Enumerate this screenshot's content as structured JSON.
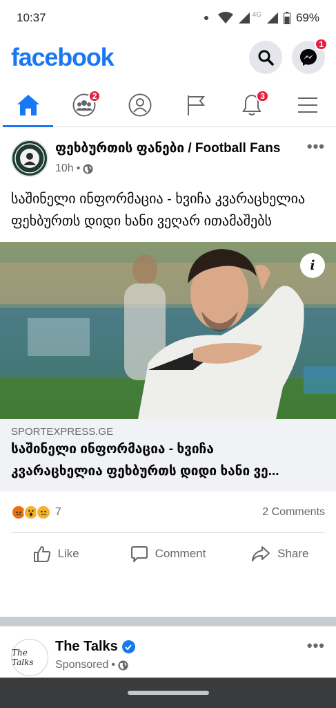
{
  "status_bar": {
    "time": "10:37",
    "network": "4G",
    "battery": "69%"
  },
  "header": {
    "logo": "facebook",
    "messenger_badge": "1"
  },
  "nav": {
    "groups_badge": "2",
    "notifications_badge": "3"
  },
  "post": {
    "page_name": "ფეხბურთის ფანები / Football Fans",
    "time": "10h",
    "dot": "•",
    "text": "საშინელი ინფორმაცია - ხვიჩა კვარაცხელია ფეხბურთს დიდი ხანი ვეღარ ითამაშებს",
    "info_glyph": "i",
    "link_domain": "SPORTEXPRESS.GE",
    "link_title_line1": "საშინელი ინფორმაცია - ხვიჩა",
    "link_title_line2": "კვარაცხელია ფეხბურთს დიდი ხანი ვე...",
    "reaction_count": "7",
    "comment_count": "2 Comments",
    "actions": {
      "like": "Like",
      "comment": "Comment",
      "share": "Share"
    },
    "reactions": [
      "angry",
      "wow",
      "sad"
    ]
  },
  "post2": {
    "page_name": "The Talks",
    "avatar_text": "The Talks",
    "sponsored": "Sponsored",
    "dot": "•"
  },
  "colors": {
    "brand": "#1877f2",
    "badge": "#e41e3f",
    "secondary_text": "#65676b"
  }
}
